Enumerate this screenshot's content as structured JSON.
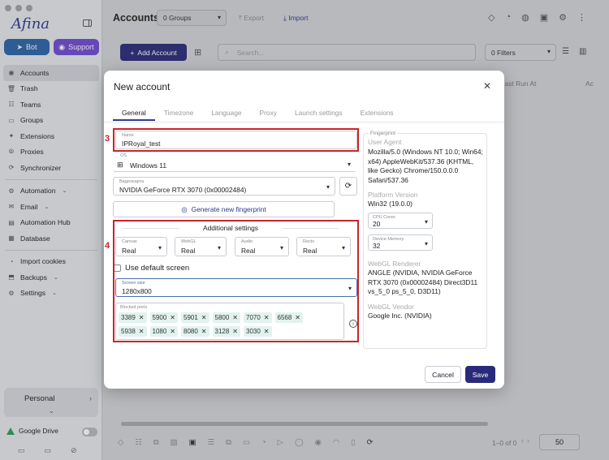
{
  "app": {
    "logo": "Afina"
  },
  "sidebar": {
    "bot_label": "Bot",
    "support_label": "Support",
    "items": [
      {
        "label": "Accounts"
      },
      {
        "label": "Trash"
      },
      {
        "label": "Teams"
      },
      {
        "label": "Groups"
      },
      {
        "label": "Extensions"
      },
      {
        "label": "Proxies"
      },
      {
        "label": "Synchronizer"
      },
      {
        "label": "Automation"
      },
      {
        "label": "Email"
      },
      {
        "label": "Automation Hub"
      },
      {
        "label": "Database"
      },
      {
        "label": "Import cookies"
      },
      {
        "label": "Backups"
      },
      {
        "label": "Settings"
      }
    ],
    "workspace": "Personal",
    "gdrive_label": "Google Drive"
  },
  "header": {
    "title": "Accounts",
    "groups_select": "0 Groups",
    "export_label": "Export",
    "import_label": "Import",
    "add_account_label": "Add Account",
    "search_placeholder": "Search...",
    "filters_label": "0 Filters",
    "col_last_run": "Last Run At",
    "col_next": "Ac"
  },
  "pager": {
    "range": "1–0 of 0",
    "per_page": "50"
  },
  "modal": {
    "title": "New account",
    "tabs": [
      "General",
      "Timezone",
      "Language",
      "Proxy",
      "Launch settings",
      "Extensions"
    ],
    "name_label": "Name",
    "name_value": "IPRoyal_test",
    "os_label": "OS",
    "os_value": "Windows 11",
    "gpu_label": "Видеокарта",
    "gpu_value": "NVIDIA GeForce RTX 3070 (0x00002484)",
    "generate_label": "Generate new fingerprint",
    "additional_label": "Additional settings",
    "selects": [
      {
        "label": "Canvas",
        "value": "Real"
      },
      {
        "label": "WebGL",
        "value": "Real"
      },
      {
        "label": "Audio",
        "value": "Real"
      },
      {
        "label": "Rects",
        "value": "Real"
      }
    ],
    "default_screen_label": "Use default screen",
    "screen_size_label": "Screen size",
    "screen_size_value": "1280x800",
    "blocked_ports_label": "Blocked ports",
    "ports": [
      "3389",
      "5900",
      "5901",
      "5800",
      "7070",
      "6568",
      "5938",
      "1080",
      "8080",
      "3128",
      "3030"
    ],
    "marker_3": "3",
    "marker_4": "4",
    "cancel_label": "Cancel",
    "save_label": "Save"
  },
  "fingerprint": {
    "title": "Fingerprint",
    "ua_label": "User Agent",
    "ua_value": "Mozilla/5.0 (Windows NT 10.0; Win64; x64) AppleWebKit/537.36 (KHTML, like Gecko) Chrome/150.0.0.0 Safari/537.36",
    "platform_label": "Platform Version",
    "platform_value": "Win32 (19.0.0)",
    "cpu_label": "CPU Cores",
    "cpu_value": "20",
    "mem_label": "Device Memory",
    "mem_value": "32",
    "renderer_label": "WebGL Renderer",
    "renderer_value": "ANGLE (NVIDIA, NVIDIA GeForce RTX 3070 (0x00002484) Direct3D11 vs_5_0 ps_5_0, D3D11)",
    "vendor_label": "WebGL Vendor",
    "vendor_value": "Google Inc. (NVIDIA)"
  },
  "colors": {
    "accent": "#2a2a7a",
    "highlight": "#c9232a",
    "chip": "#e2f3ef"
  }
}
